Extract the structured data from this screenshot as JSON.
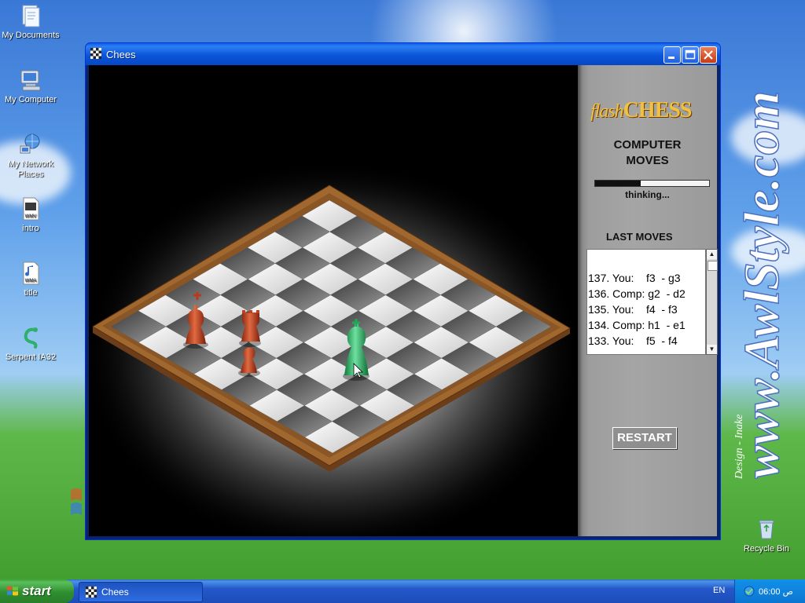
{
  "desktop": {
    "icons": [
      {
        "label": "My Documents"
      },
      {
        "label": "My Computer"
      },
      {
        "label": "My Network Places"
      },
      {
        "label": "intro"
      },
      {
        "label": "title"
      },
      {
        "label": "Serpent IA32"
      },
      {
        "label": "Recycle Bin"
      }
    ],
    "watermark_text": "www.AwlStyle.com",
    "watermark_small": "Design - Inake"
  },
  "window": {
    "title": "Chees",
    "buttons": [
      "minimize",
      "maximize",
      "close"
    ]
  },
  "game": {
    "logo_italic": "flash",
    "logo_bold": "CHESS",
    "status_line1": "COMPUTER",
    "status_line2": "MOVES",
    "progress": 0.4,
    "thinking_text": "thinking...",
    "last_moves_title": "LAST MOVES",
    "moves": [
      "137. You:    f3  - g3",
      "136. Comp: g2  - d2",
      "135. You:    f4  - f3",
      "134. Comp: h1  - e1",
      "133. You:    f5  - f4"
    ],
    "restart_label": "RESTART",
    "pieces": [
      {
        "name": "red-king",
        "color": "#b83a1e"
      },
      {
        "name": "red-rook",
        "color": "#c24020"
      },
      {
        "name": "red-pawn",
        "color": "#c24020"
      },
      {
        "name": "green-king",
        "color": "#1fa85a"
      }
    ]
  },
  "taskbar": {
    "start_label": "start",
    "task_title": "Chees",
    "language": "EN",
    "clock": "06:00 ص"
  },
  "colors": {
    "taskbar_blue": "#245edb",
    "start_green": "#3c9a3c",
    "board_frame": "#8b5a2b",
    "panel_gray": "#a0a0a0"
  }
}
